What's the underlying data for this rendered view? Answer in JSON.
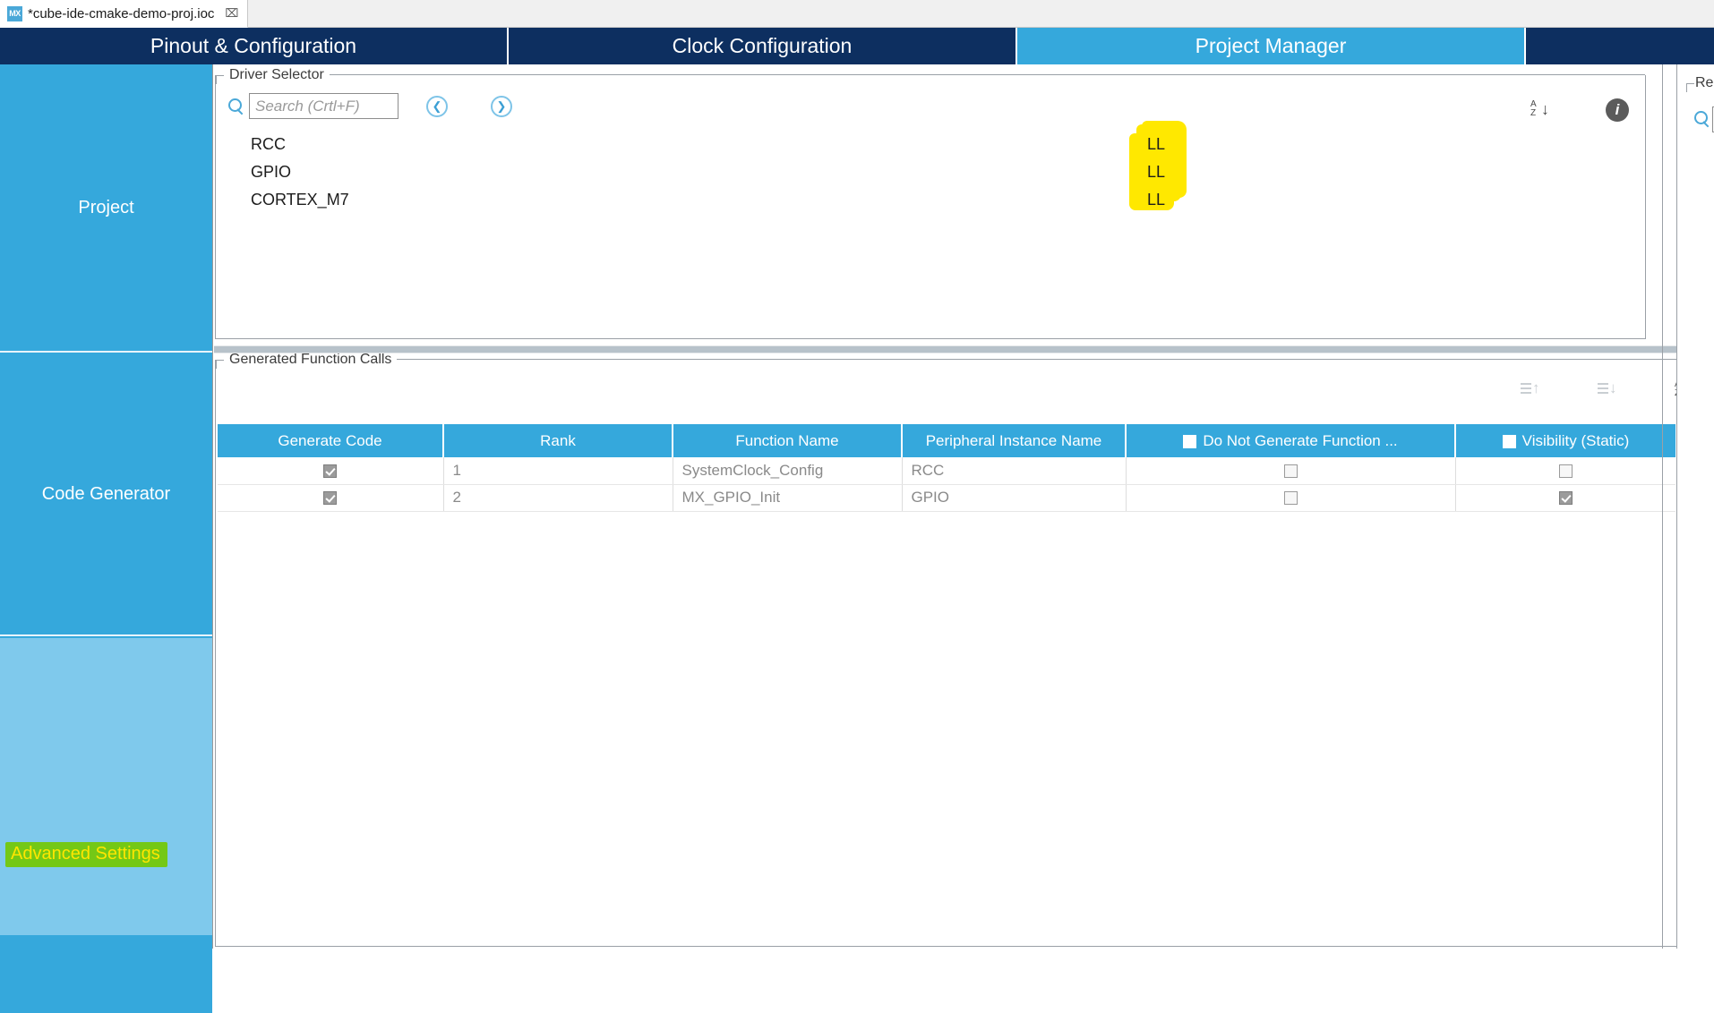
{
  "window": {
    "document_tab": {
      "icon": "mx-logo-icon",
      "title": "*cube-ide-cmake-demo-proj.ioc",
      "close_glyph": "⌧"
    }
  },
  "main_tabs": [
    {
      "label": "Pinout & Configuration",
      "active": false
    },
    {
      "label": "Clock Configuration",
      "active": false
    },
    {
      "label": "Project Manager",
      "active": true
    }
  ],
  "sidebar": {
    "items": [
      {
        "label": "Project",
        "active": false
      },
      {
        "label": "Code Generator",
        "active": false
      },
      {
        "label": "Advanced Settings",
        "active": true,
        "highlighted": true
      }
    ]
  },
  "driver_selector": {
    "title": "Driver Selector",
    "search": {
      "placeholder": "Search (Crtl+F)",
      "value": "",
      "icon": "search-icon"
    },
    "nav_prev_icon": "chevron-left-circle-icon",
    "nav_next_icon": "chevron-right-circle-icon",
    "sort_icon": "sort-az-icon",
    "info_icon": "info-circle-icon",
    "drivers": [
      {
        "name": "RCC",
        "driver": "LL"
      },
      {
        "name": "GPIO",
        "driver": "LL"
      },
      {
        "name": "CORTEX_M7",
        "driver": "LL"
      }
    ]
  },
  "generated_function_calls": {
    "title": "Generated Function Calls",
    "tools": [
      {
        "icon": "move-up-icon",
        "enabled": false
      },
      {
        "icon": "move-down-icon",
        "enabled": false
      },
      {
        "icon": "sort-az-icon",
        "enabled": true
      }
    ],
    "columns": [
      {
        "label": "Generate Code",
        "has_header_checkbox": false
      },
      {
        "label": "Rank",
        "has_header_checkbox": false
      },
      {
        "label": "Function Name",
        "has_header_checkbox": false
      },
      {
        "label": "Peripheral Instance Name",
        "has_header_checkbox": false
      },
      {
        "label": "Do Not Generate Function ...",
        "has_header_checkbox": true,
        "header_checked": false
      },
      {
        "label": "Visibility (Static)",
        "has_header_checkbox": true,
        "header_checked": false
      }
    ],
    "rows": [
      {
        "generate_code": true,
        "rank": "1",
        "function_name": "SystemClock_Config",
        "peripheral_instance_name": "RCC",
        "do_not_generate": false,
        "visibility_static": false
      },
      {
        "generate_code": true,
        "rank": "2",
        "function_name": "MX_GPIO_Init",
        "peripheral_instance_name": "GPIO",
        "do_not_generate": false,
        "visibility_static": true
      }
    ]
  },
  "right_panel": {
    "title": "Re",
    "search_icon": "search-icon",
    "search_value": ""
  },
  "colors": {
    "navy": "#0d2f60",
    "accent_blue": "#35a8dc",
    "light_blue": "#7fc9ec",
    "highlight_yellow": "#ffe800",
    "highlight_green": "#74c816",
    "highlight_text_yellow": "#ffe600"
  }
}
